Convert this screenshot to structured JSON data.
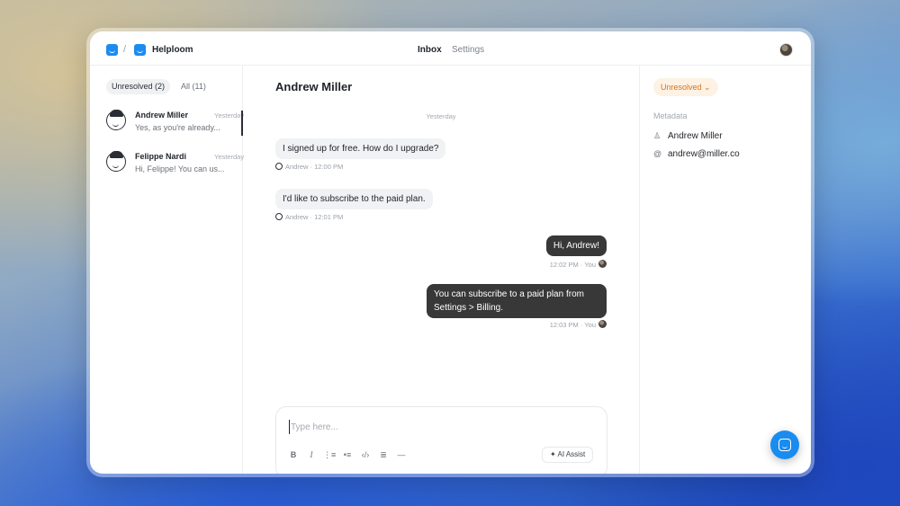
{
  "topbar": {
    "separator": "/",
    "brand": "Helploom",
    "nav": [
      {
        "label": "Inbox",
        "active": true
      },
      {
        "label": "Settings",
        "active": false
      }
    ],
    "logo_icon": "chat-logo-icon",
    "accent": "#1a8cf0"
  },
  "sidebar": {
    "filters": [
      {
        "label": "Unresolved (2)",
        "active": true
      },
      {
        "label": "All (11)",
        "active": false
      }
    ],
    "conversations": [
      {
        "name": "Andrew Miller",
        "time": "Yesterday",
        "preview": "Yes, as you're already...",
        "selected": true
      },
      {
        "name": "Felippe Nardi",
        "time": "Yesterday",
        "preview": "Hi, Felippe! You can us...",
        "selected": false
      }
    ]
  },
  "chat": {
    "title": "Andrew Miller",
    "date_divider": "Yesterday",
    "messages": [
      {
        "direction": "in",
        "text": "I signed up for free. How do I upgrade?",
        "meta": "Andrew · 12:00 PM"
      },
      {
        "direction": "in",
        "text": "I'd like to subscribe to the paid plan.",
        "meta": "Andrew · 12:01 PM"
      },
      {
        "direction": "out",
        "text": "Hi, Andrew!",
        "meta": "12:02 PM · You"
      },
      {
        "direction": "out",
        "text": "You can subscribe to a paid plan from Settings > Billing.",
        "meta": "12:03 PM · You"
      }
    ],
    "composer": {
      "placeholder": "Type here...",
      "value": "",
      "tools": [
        "bold-icon",
        "italic-icon",
        "ordered-list-icon",
        "bullet-list-icon",
        "code-icon",
        "quote-icon",
        "divider-icon"
      ],
      "ai_button": "AI Assist"
    }
  },
  "details": {
    "status": "Unresolved",
    "status_color": "#d9731a",
    "metadata_label": "Metadata",
    "name": "Andrew Miller",
    "email": "andrew@miller.co"
  }
}
